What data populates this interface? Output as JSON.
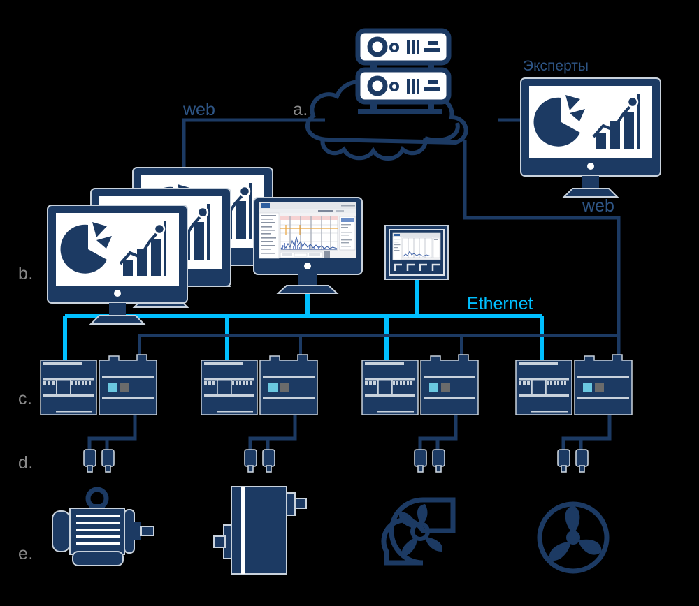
{
  "diagram": {
    "title": "Industrial condition monitoring system architecture",
    "background_color": "#000000",
    "colors": {
      "navy": "#1c3a63",
      "navy_dark": "#16314f",
      "outline": "#c9d2dc",
      "cyan": "#00bfff",
      "cyan_indicator": "#6bc8e0",
      "gray_indicator": "#6b6b6b",
      "label_gray": "#8a8a8a",
      "label_navy": "#2e5585",
      "screen_white": "#ffffff"
    }
  },
  "labels": {
    "tier_a": "a.",
    "tier_b": "b.",
    "tier_c": "c.",
    "tier_d": "d.",
    "tier_e": "e.",
    "web_left": "web",
    "web_right": "web",
    "ethernet": "Ethernet",
    "experts": "Эксперты"
  },
  "nodes": {
    "cloud": {
      "name": "cloud",
      "icon": "cloud-icon",
      "servers": 2
    },
    "experts_workstation": {
      "name": "experts-workstation",
      "icon": "monitor-analytics-icon",
      "caption": "Эксперты"
    },
    "operator_monitors": {
      "name": "operator-monitor-stack",
      "icon": "monitor-analytics-icon",
      "count": 3
    },
    "analysis_workstation": {
      "name": "analysis-workstation",
      "icon": "monitor-software-icon"
    },
    "hmi_panel": {
      "name": "hmi-panel",
      "icon": "hmi-panel-icon",
      "function_keys": 4
    },
    "controllers": [
      {
        "name": "plc-1",
        "icon": "plc-icon",
        "indicators": [
          "cyan",
          "gray"
        ]
      },
      {
        "name": "plc-2",
        "icon": "plc-icon",
        "indicators": [
          "cyan",
          "gray"
        ]
      },
      {
        "name": "plc-3",
        "icon": "plc-icon",
        "indicators": [
          "cyan",
          "gray"
        ]
      },
      {
        "name": "plc-4",
        "icon": "plc-icon",
        "indicators": [
          "cyan",
          "gray"
        ]
      }
    ],
    "sensor_pairs": [
      {
        "name": "sensor-pair-1",
        "icon": "vibration-sensor-icon",
        "count": 2
      },
      {
        "name": "sensor-pair-2",
        "icon": "vibration-sensor-icon",
        "count": 2
      },
      {
        "name": "sensor-pair-3",
        "icon": "vibration-sensor-icon",
        "count": 2
      },
      {
        "name": "sensor-pair-4",
        "icon": "vibration-sensor-icon",
        "count": 2
      }
    ],
    "machines": [
      {
        "name": "machine-electric-motor",
        "icon": "electric-motor-icon"
      },
      {
        "name": "machine-gearbox",
        "icon": "gearbox-icon"
      },
      {
        "name": "machine-centrifugal-blower",
        "icon": "centrifugal-blower-icon"
      },
      {
        "name": "machine-axial-fan",
        "icon": "axial-fan-icon"
      }
    ]
  },
  "software_screen": {
    "name": "monitoring-software-window",
    "has_sidebar": true,
    "chart_bands": 5,
    "trace_color": "#3f62a8",
    "threshold_color": "#e8a33d"
  },
  "links": {
    "ethernet_bus": {
      "name": "ethernet-bus",
      "color": "#00bfff"
    },
    "web_link_left": {
      "name": "web-link-left",
      "color": "#1c3a63"
    },
    "web_link_right": {
      "name": "web-link-right",
      "color": "#1c3a63"
    }
  }
}
